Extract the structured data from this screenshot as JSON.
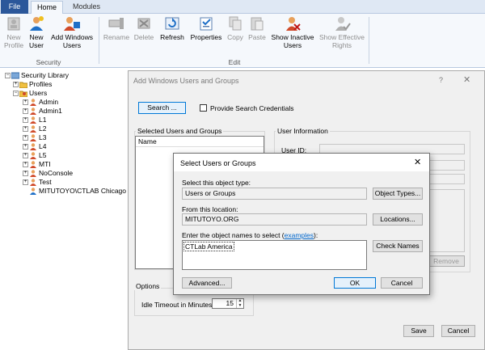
{
  "ribbon_tabs": {
    "file": "File",
    "home": "Home",
    "modules": "Modules"
  },
  "ribbon": {
    "security_buttons": [
      {
        "line1": "New",
        "line2": "Profile",
        "icon": "new-profile-icon",
        "enabled": false
      },
      {
        "line1": "New",
        "line2": "User",
        "icon": "new-user-icon",
        "enabled": true
      },
      {
        "line1": "Add Windows",
        "line2": "Users",
        "icon": "add-windows-users-icon",
        "enabled": true
      }
    ],
    "security_group": "Security",
    "edit_buttons": [
      {
        "line1": "Rename",
        "line2": "",
        "icon": "rename-icon",
        "enabled": false
      },
      {
        "line1": "Delete",
        "line2": "",
        "icon": "delete-icon",
        "enabled": false
      },
      {
        "line1": "Refresh",
        "line2": "",
        "icon": "refresh-icon",
        "enabled": true
      },
      {
        "line1": "Properties",
        "line2": "",
        "icon": "properties-icon",
        "enabled": true
      },
      {
        "line1": "Copy",
        "line2": "",
        "icon": "copy-icon",
        "enabled": false
      },
      {
        "line1": "Paste",
        "line2": "",
        "icon": "paste-icon",
        "enabled": false
      },
      {
        "line1": "Show Inactive",
        "line2": "Users",
        "icon": "show-inactive-users-icon",
        "enabled": true
      },
      {
        "line1": "Show Effective",
        "line2": "Rights",
        "icon": "show-effective-rights-icon",
        "enabled": false
      }
    ],
    "edit_group": "Edit"
  },
  "tree": {
    "root": "Security Library",
    "profiles": "Profiles",
    "users": "Users",
    "user_items": [
      "Admin",
      "Admin1",
      "L1",
      "L2",
      "L3",
      "L4",
      "L5",
      "MTI",
      "NoConsole",
      "Test",
      "MITUTOYO\\CTLAB Chicago"
    ]
  },
  "add_dialog": {
    "title": "Add Windows Users and Groups",
    "help": "?",
    "close": "✕",
    "search_button": "Search ...",
    "provide_credentials": "Provide Search Credentials",
    "selected_users_legend": "Selected Users and Groups",
    "name_column": "Name",
    "user_info_legend": "User Information",
    "user_id_label": "User ID:",
    "remove_button": "Remove",
    "options_legend": "Options",
    "idle_timeout_label": "Idle Timeout in Minutes:",
    "idle_timeout_value": "15",
    "save_button": "Save",
    "cancel_button": "Cancel"
  },
  "select_dialog": {
    "title": "Select Users or Groups",
    "close": "✕",
    "object_type_label": "Select this object type:",
    "object_type_value": "Users or Groups",
    "object_types_button": "Object Types...",
    "location_label": "From this location:",
    "location_value": "MITUTOYO.ORG",
    "locations_button": "Locations...",
    "names_label_prefix": "Enter the object names to select (",
    "names_label_link": "examples",
    "names_label_suffix": "):",
    "names_value": "CTLab America",
    "check_names_button": "Check Names",
    "advanced_button": "Advanced...",
    "ok_button": "OK",
    "cancel_button": "Cancel"
  }
}
